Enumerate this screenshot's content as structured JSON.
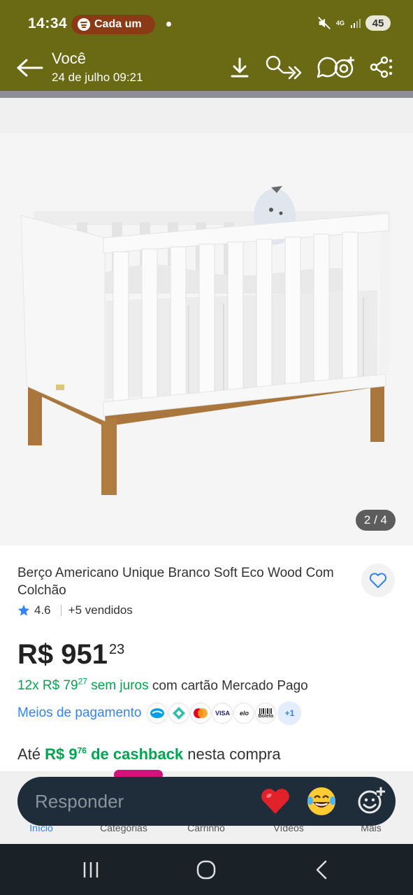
{
  "status_bar": {
    "time": "14:34",
    "now_playing": "Cada um",
    "network": "4G",
    "battery": "45"
  },
  "header": {
    "contact_name": "Você",
    "timestamp": "24 de julho 09:21",
    "background_color": "#6b6a14"
  },
  "image": {
    "counter": "2 / 4"
  },
  "product": {
    "title": "Berço Americano Unique Branco Soft Eco Wood Com Colchão",
    "rating": "4.6",
    "sold": "+5 vendidos",
    "price_main": "R$ 951",
    "price_cents": "23",
    "installments_prefix": "12x R$ 79",
    "installments_cents": "27",
    "installments_suffix": " sem juros",
    "installments_tail": " com cartão Mercado Pago",
    "payment_link": "Meios de pagamento",
    "payment_more": "+1",
    "payment_methods": [
      "elo",
      "VISA",
      "Boleto"
    ],
    "cashback_prefix": "Até ",
    "cashback_value": "R$ 9",
    "cashback_cents": "76",
    "cashback_label": " de cashback",
    "cashback_tail": " nesta compra",
    "accent_green": "#00a650",
    "accent_blue": "#3483fa"
  },
  "app_nav": {
    "items": [
      "Início",
      "Categorias",
      "Carrinho",
      "Vídeos",
      "Mais"
    ]
  },
  "reply": {
    "placeholder": "Responder"
  }
}
